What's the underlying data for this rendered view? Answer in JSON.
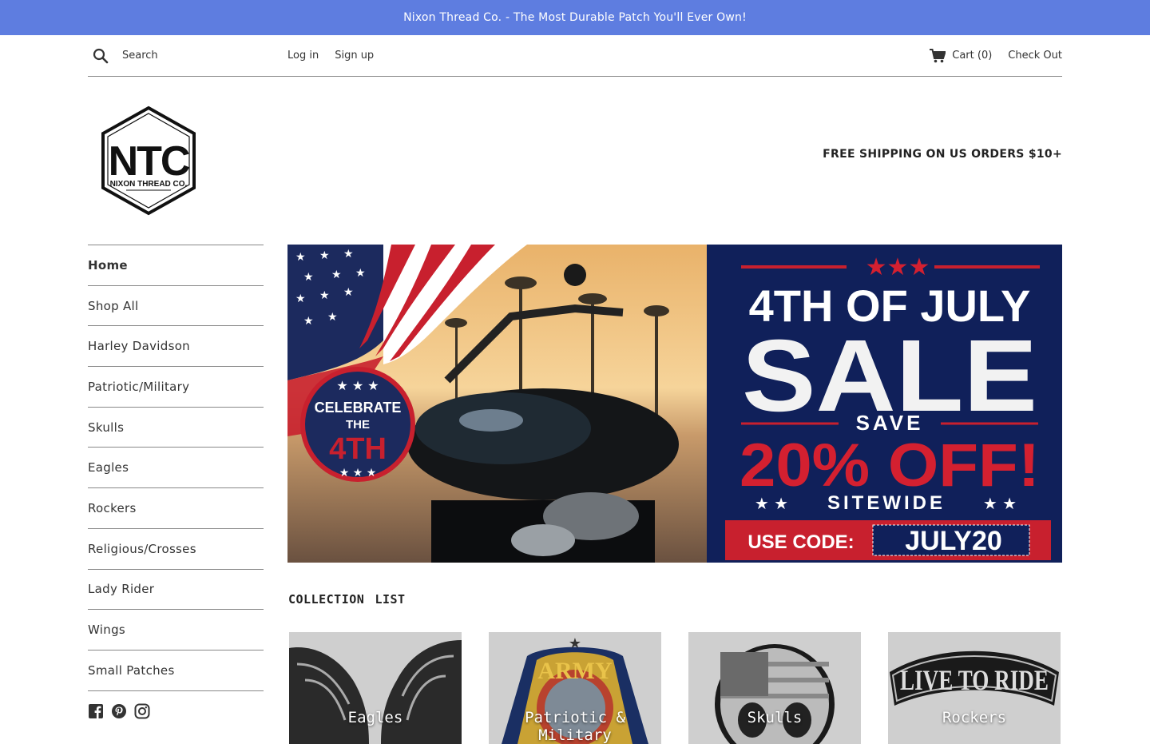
{
  "announcement": "Nixon Thread Co. - The Most Durable Patch You'll Ever Own!",
  "search": {
    "placeholder": "Search"
  },
  "account": {
    "login": "Log in",
    "signup": "Sign up"
  },
  "cart": {
    "label": "Cart (0)",
    "checkout": "Check Out"
  },
  "logo": {
    "text": "NTC",
    "subtext": "NIXON THREAD CO."
  },
  "promo": "FREE SHIPPING ON US ORDERS $10+",
  "nav": [
    {
      "label": "Home",
      "active": true
    },
    {
      "label": "Shop All"
    },
    {
      "label": "Harley Davidson"
    },
    {
      "label": "Patriotic/Military"
    },
    {
      "label": "Skulls"
    },
    {
      "label": "Eagles"
    },
    {
      "label": "Rockers"
    },
    {
      "label": "Religious/Crosses"
    },
    {
      "label": "Lady Rider"
    },
    {
      "label": "Wings"
    },
    {
      "label": "Small Patches"
    }
  ],
  "social": [
    "facebook-icon",
    "pinterest-icon",
    "instagram-icon"
  ],
  "banner": {
    "badge_line1": "CELEBRATE",
    "badge_line2": "THE",
    "badge_line3": "4TH",
    "headline": "4TH OF JULY",
    "sale": "SALE",
    "save": "SAVE",
    "discount": "20% OFF!",
    "sitewide": "SITEWIDE",
    "code_label": "USE CODE:",
    "code": "JULY20"
  },
  "collection_title": "Collection list",
  "collections": [
    {
      "label": "Eagles"
    },
    {
      "label": "Patriotic & Military"
    },
    {
      "label": "Skulls"
    },
    {
      "label": "Rockers"
    }
  ],
  "colors": {
    "announcement_bg": "#5e7de0",
    "banner_navy": "#10205a",
    "banner_red": "#d42030"
  }
}
